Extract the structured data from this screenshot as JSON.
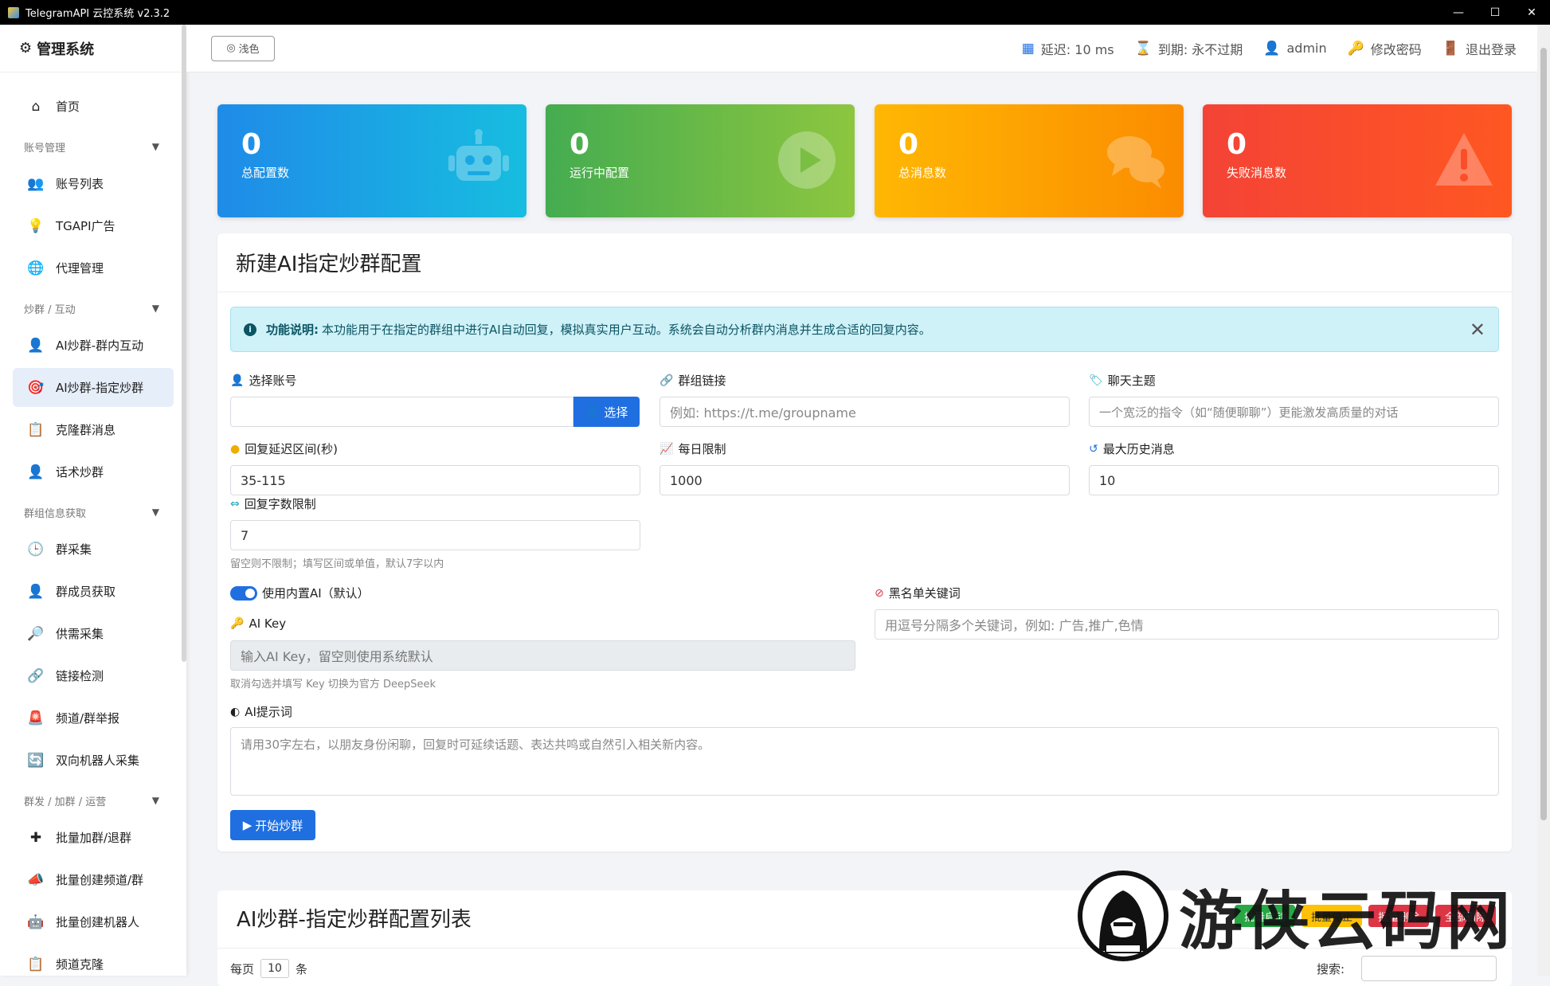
{
  "window": {
    "title": "TelegramAPI 云控系统 v2.3.2",
    "controls": [
      "—",
      "☐",
      "✕"
    ]
  },
  "sidebar": {
    "brand": "管理系统",
    "items": [
      {
        "type": "item",
        "label": "首页",
        "icon": "home-icon",
        "glyph": "⌂"
      },
      {
        "type": "group",
        "label": "账号管理"
      },
      {
        "type": "item",
        "label": "账号列表",
        "icon": "users-icon",
        "glyph": "👥"
      },
      {
        "type": "item",
        "label": "TGAPI广告",
        "icon": "lightbulb-icon",
        "glyph": "💡"
      },
      {
        "type": "item",
        "label": "代理管理",
        "icon": "globe-icon",
        "glyph": "🌐"
      },
      {
        "type": "group",
        "label": "炒群 / 互动"
      },
      {
        "type": "item",
        "label": "AI炒群-群内互动",
        "icon": "user-chat-icon",
        "glyph": "👤"
      },
      {
        "type": "item",
        "label": "AI炒群-指定炒群",
        "icon": "target-icon",
        "glyph": "🎯",
        "active": true
      },
      {
        "type": "item",
        "label": "克隆群消息",
        "icon": "clipboard-icon",
        "glyph": "📋"
      },
      {
        "type": "item",
        "label": "话术炒群",
        "icon": "user-speak-icon",
        "glyph": "👤"
      },
      {
        "type": "group",
        "label": "群组信息获取"
      },
      {
        "type": "item",
        "label": "群采集",
        "icon": "clock-icon",
        "glyph": "🕒"
      },
      {
        "type": "item",
        "label": "群成员获取",
        "icon": "member-icon",
        "glyph": "👤"
      },
      {
        "type": "item",
        "label": "供需采集",
        "icon": "magnifier-icon",
        "glyph": "🔎"
      },
      {
        "type": "item",
        "label": "链接检测",
        "icon": "link-check-icon",
        "glyph": "🔗"
      },
      {
        "type": "item",
        "label": "频道/群举报",
        "icon": "siren-icon",
        "glyph": "🚨"
      },
      {
        "type": "item",
        "label": "双向机器人采集",
        "icon": "refresh-icon",
        "glyph": "🔄"
      },
      {
        "type": "group",
        "label": "群发 / 加群 / 运营"
      },
      {
        "type": "item",
        "label": "批量加群/退群",
        "icon": "plus-cross-icon",
        "glyph": "✚"
      },
      {
        "type": "item",
        "label": "批量创建频道/群",
        "icon": "megaphone-icon",
        "glyph": "📣"
      },
      {
        "type": "item",
        "label": "批量创建机器人",
        "icon": "robot-icon",
        "glyph": "🤖"
      },
      {
        "type": "item",
        "label": "频道克隆",
        "icon": "copy-icon",
        "glyph": "📋"
      }
    ]
  },
  "topbar": {
    "theme_label": "浅色",
    "latency": "延迟: 10 ms",
    "expiry": "到期: 永不过期",
    "user": "admin",
    "change_password": "修改密码",
    "logout": "退出登录"
  },
  "stats": [
    {
      "value": "0",
      "label": "总配置数"
    },
    {
      "value": "0",
      "label": "运行中配置"
    },
    {
      "value": "0",
      "label": "总消息数"
    },
    {
      "value": "0",
      "label": "失败消息数"
    }
  ],
  "form": {
    "title": "新建AI指定炒群配置",
    "alert_bold": "功能说明:",
    "alert_text": "本功能用于在指定的群组中进行AI自动回复，模拟真实用户互动。系统会自动分析群内消息并生成合适的回复内容。",
    "account_label": "选择账号",
    "account_value": "",
    "select_btn": "选择",
    "group_link_label": "群组链接",
    "group_link_placeholder": "例如: https://t.me/groupname",
    "topic_label": "聊天主题",
    "topic_placeholder": "一个宽泛的指令（如“随便聊聊”）更能激发高质量的对话",
    "delay_label": "回复延迟区间(秒)",
    "delay_value": "35-115",
    "daily_label": "每日限制",
    "daily_value": "1000",
    "history_label": "最大历史消息",
    "history_value": "10",
    "charlimit_label": "回复字数限制",
    "charlimit_value": "7",
    "charlimit_help": "留空则不限制；填写区间或单值，默认7字以内",
    "builtin_ai_label": "使用内置AI（默认）",
    "blacklist_label": "黑名单关键词",
    "blacklist_placeholder": "用逗号分隔多个关键词，例如: 广告,推广,色情",
    "aikey_label": "AI Key",
    "aikey_placeholder": "输入AI Key，留空则使用系统默认",
    "aikey_help": "取消勾选并填写 Key 切换为官方 DeepSeek",
    "prompt_label": "AI提示词",
    "prompt_placeholder": "请用30字左右，以朋友身份闲聊，回复时可延续话题、表达共鸣或自然引入相关新内容。",
    "start_btn": "开始炒群"
  },
  "list": {
    "title": "AI炒群-指定炒群配置列表",
    "actions": [
      "批量启动",
      "批量停止",
      "批量删除",
      "全部删除"
    ],
    "per_page_prefix": "每页",
    "per_page_value": "10",
    "per_page_suffix": "条",
    "search_label": "搜索:"
  },
  "watermark": {
    "text": "游侠云码网"
  },
  "colors": {
    "primary": "#1f6fe0",
    "blue_card": "#1f8be8",
    "green_card": "#44ac50",
    "yellow_card": "#ffb703",
    "red_card": "#f44336"
  }
}
